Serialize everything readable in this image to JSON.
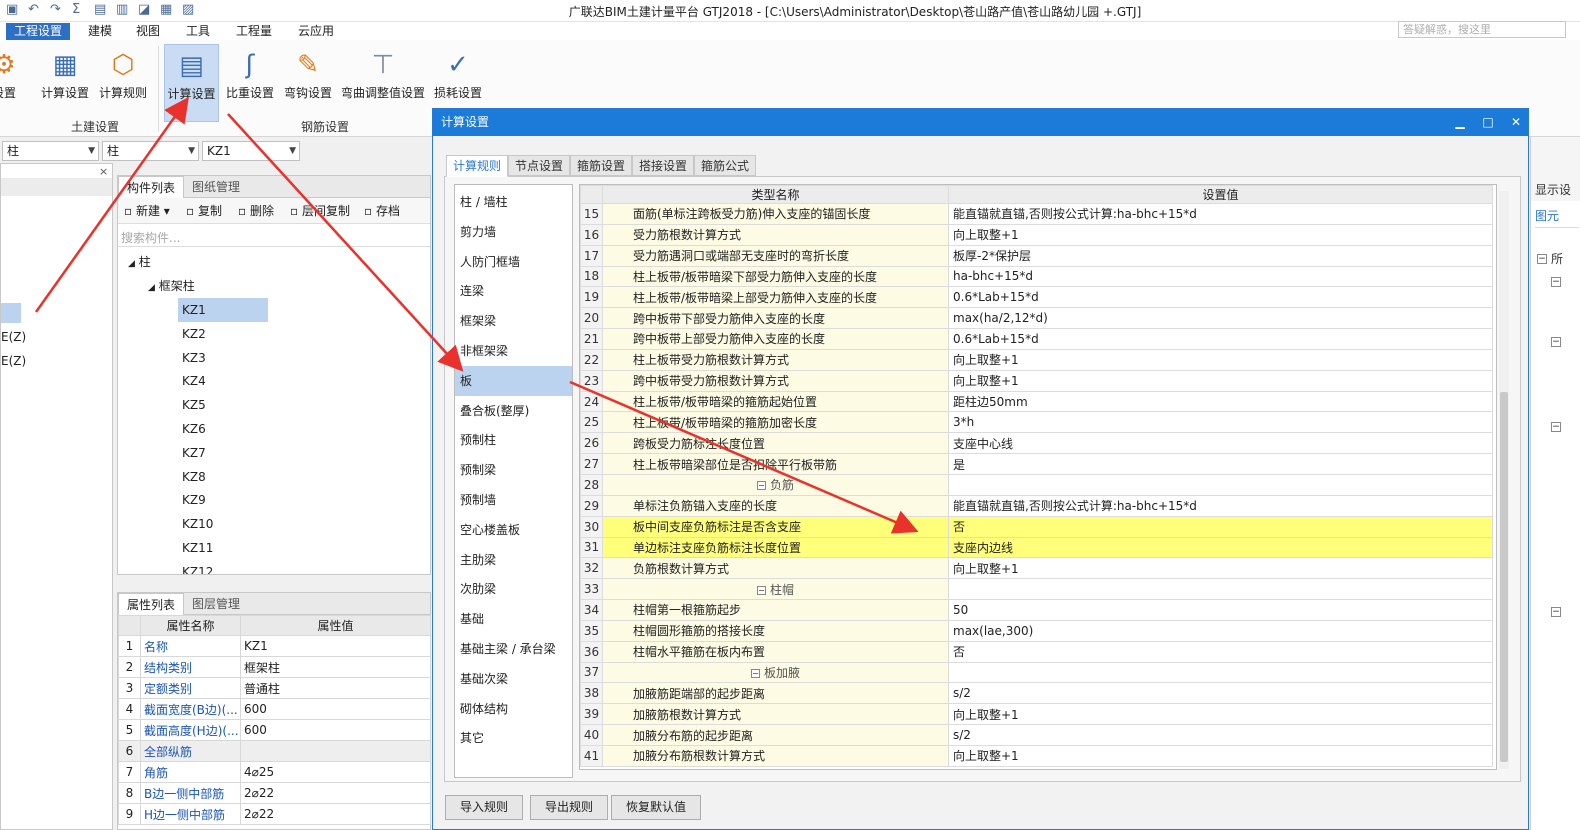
{
  "window": {
    "title": "广联达BIM土建计量平台 GTJ2018 - [C:\\Users\\Administrator\\Desktop\\苍山路产值\\苍山路幼儿园 +.GTJ]"
  },
  "quick_access": [
    "▣",
    "↶",
    "↷",
    "Σ",
    "▤",
    "▥",
    "◪",
    "▦",
    "▨"
  ],
  "menu": {
    "items": [
      "工程设置",
      "建模",
      "视图",
      "工具",
      "工程量",
      "云应用"
    ],
    "search_placeholder": "答疑解惑，搜这里"
  },
  "ribbon": {
    "partial_label": "设置",
    "btn1": "计算设置",
    "btn2": "计算规则",
    "btn3": "计算设置",
    "btn4": "比重设置",
    "btn5": "弯钩设置",
    "btn6": "弯曲调整值设置",
    "btn7": "损耗设置",
    "group1": "土建设置",
    "group2": "钢筋设置"
  },
  "combos": {
    "c1": "柱",
    "c2": "柱",
    "c3": "KZ1"
  },
  "left_stub": {
    "item1": "E(Z)",
    "item2": "E(Z)"
  },
  "component_panel": {
    "tab1": "构件列表",
    "tab2": "图纸管理",
    "new_btn": "新建",
    "copy_btn": "复制",
    "delete_btn": "删除",
    "layer_copy_btn": "层间复制",
    "save_btn": "存档",
    "search_placeholder": "搜索构件...",
    "tree_root": "柱",
    "tree_child": "框架柱",
    "items": [
      "KZ1",
      "KZ2",
      "KZ3",
      "KZ4",
      "KZ5",
      "KZ6",
      "KZ7",
      "KZ8",
      "KZ9",
      "KZ10",
      "KZ11",
      "KZ12"
    ]
  },
  "property_panel": {
    "tab1": "属性列表",
    "tab2": "图层管理",
    "col_name": "属性名称",
    "col_value": "属性值",
    "rows": [
      [
        "1",
        "名称",
        "KZ1"
      ],
      [
        "2",
        "结构类别",
        "框架柱"
      ],
      [
        "3",
        "定额类别",
        "普通柱"
      ],
      [
        "4",
        "截面宽度(B边)(...",
        "600"
      ],
      [
        "5",
        "截面高度(H边)(...",
        "600"
      ],
      [
        "6",
        "全部纵筋",
        ""
      ],
      [
        "7",
        "角筋",
        "4⌀25"
      ],
      [
        "8",
        "B边一侧中部筋",
        "2⌀22"
      ],
      [
        "9",
        "H边一侧中部筋",
        "2⌀22"
      ]
    ]
  },
  "dialog": {
    "title": "计算设置",
    "min": "▁",
    "max": "□",
    "close": "✕",
    "tabs": [
      "计算规则",
      "节点设置",
      "箍筋设置",
      "搭接设置",
      "箍筋公式"
    ],
    "categories": [
      "柱 / 墙柱",
      "剪力墙",
      "人防门框墙",
      "连梁",
      "框架梁",
      "非框架梁",
      "板",
      "叠合板(整厚)",
      "预制柱",
      "预制梁",
      "预制墙",
      "空心楼盖板",
      "主肋梁",
      "次肋梁",
      "基础",
      "基础主梁 / 承台梁",
      "基础次梁",
      "砌体结构",
      "其它"
    ],
    "col_type": "类型名称",
    "col_value": "设置值",
    "rows": [
      {
        "no": "15",
        "name": "面筋(单标注跨板受力筋)伸入支座的锚固长度",
        "value": "能直锚就直锚,否则按公式计算:ha-bhc+15*d"
      },
      {
        "no": "16",
        "name": "受力筋根数计算方式",
        "value": "向上取整+1"
      },
      {
        "no": "17",
        "name": "受力筋遇洞口或端部无支座时的弯折长度",
        "value": "板厚-2*保护层"
      },
      {
        "no": "18",
        "name": "柱上板带/板带暗梁下部受力筋伸入支座的长度",
        "value": "ha-bhc+15*d"
      },
      {
        "no": "19",
        "name": "柱上板带/板带暗梁上部受力筋伸入支座的长度",
        "value": "0.6*Lab+15*d"
      },
      {
        "no": "20",
        "name": "跨中板带下部受力筋伸入支座的长度",
        "value": "max(ha/2,12*d)"
      },
      {
        "no": "21",
        "name": "跨中板带上部受力筋伸入支座的长度",
        "value": "0.6*Lab+15*d"
      },
      {
        "no": "22",
        "name": "柱上板带受力筋根数计算方式",
        "value": "向上取整+1"
      },
      {
        "no": "23",
        "name": "跨中板带受力筋根数计算方式",
        "value": "向上取整+1"
      },
      {
        "no": "24",
        "name": "柱上板带/板带暗梁的箍筋起始位置",
        "value": "距柱边50mm"
      },
      {
        "no": "25",
        "name": "柱上板带/板带暗梁的箍筋加密长度",
        "value": "3*h"
      },
      {
        "no": "26",
        "name": "跨板受力筋标注长度位置",
        "value": "支座中心线"
      },
      {
        "no": "27",
        "name": "柱上板带暗梁部位是否扣除平行板带筋",
        "value": "是"
      },
      {
        "no": "28",
        "group": "负筋"
      },
      {
        "no": "29",
        "name": "单标注负筋锚入支座的长度",
        "value": "能直锚就直锚,否则按公式计算:ha-bhc+15*d"
      },
      {
        "no": "30",
        "name": "板中间支座负筋标注是否含支座",
        "value": "否",
        "hl": true
      },
      {
        "no": "31",
        "name": "单边标注支座负筋标注长度位置",
        "value": "支座内边线",
        "hl": true
      },
      {
        "no": "32",
        "name": "负筋根数计算方式",
        "value": "向上取整+1"
      },
      {
        "no": "33",
        "group": "柱帽"
      },
      {
        "no": "34",
        "name": "柱帽第一根箍筋起步",
        "value": "50"
      },
      {
        "no": "35",
        "name": "柱帽圆形箍筋的搭接长度",
        "value": "max(lae,300)"
      },
      {
        "no": "36",
        "name": "柱帽水平箍筋在板内布置",
        "value": "否"
      },
      {
        "no": "37",
        "group": "板加腋"
      },
      {
        "no": "38",
        "name": "加腋筋距端部的起步距离",
        "value": "s/2"
      },
      {
        "no": "39",
        "name": "加腋筋根数计算方式",
        "value": "向上取整+1"
      },
      {
        "no": "40",
        "name": "加腋分布筋的起步距离",
        "value": "s/2"
      },
      {
        "no": "41",
        "name": "加腋分布筋根数计算方式",
        "value": "向上取整+1"
      }
    ],
    "buttons": {
      "import": "导入规则",
      "export": "导出规则",
      "restore": "恢复默认值"
    }
  },
  "right_panel": {
    "label1": "显示设",
    "label2": "图元",
    "label3": "所"
  },
  "colors": {
    "accent": "#1c7bd8",
    "highlight": "#ffff7a",
    "arrow": "#e8322b"
  }
}
